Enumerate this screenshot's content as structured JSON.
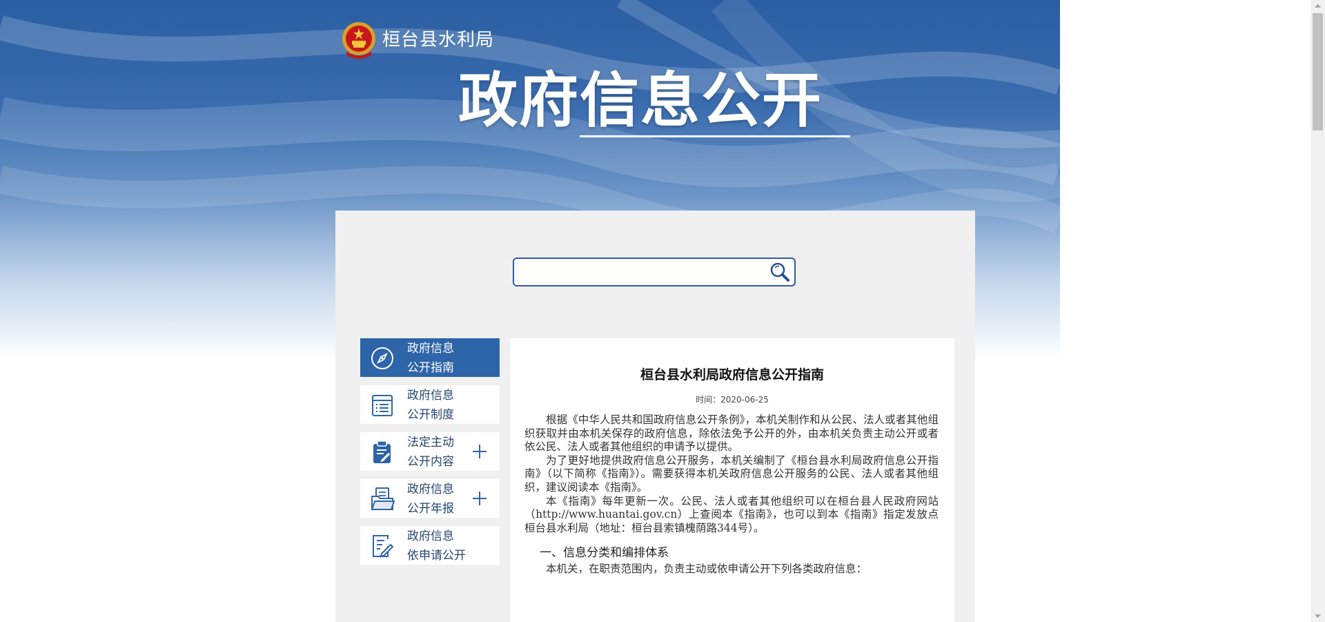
{
  "header": {
    "department": "桓台县水利局",
    "title": "政府信息公开"
  },
  "search": {
    "placeholder": "",
    "value": ""
  },
  "sidebar": {
    "items": [
      {
        "line1": "政府信息",
        "line2": "公开指南",
        "icon": "compass-icon",
        "active": true,
        "expandable": false
      },
      {
        "line1": "政府信息",
        "line2": "公开制度",
        "icon": "list-document-icon",
        "active": false,
        "expandable": false
      },
      {
        "line1": "法定主动",
        "line2": "公开内容",
        "icon": "clipboard-edit-icon",
        "active": false,
        "expandable": true
      },
      {
        "line1": "政府信息",
        "line2": "公开年报",
        "icon": "folder-document-icon",
        "active": false,
        "expandable": true
      },
      {
        "line1": "政府信息",
        "line2": "依申请公开",
        "icon": "form-pen-icon",
        "active": false,
        "expandable": false
      }
    ]
  },
  "article": {
    "title": "桓台县水利局政府信息公开指南",
    "date_label": "时间：",
    "date": "2020-06-25",
    "paragraphs": [
      "根据《中华人民共和国政府信息公开条例》，本机关制作和从公民、法人或者其他组织获取并由本机关保存的政府信息，除依法免予公开的外，由本机关负责主动公开或者依公民、法人或者其他组织的申请予以提供。",
      "为了更好地提供政府信息公开服务，本机关编制了《桓台县水利局政府信息公开指南》（以下简称《指南》）。需要获得本机关政府信息公开服务的公民、法人或者其他组织，建议阅读本《指南》。",
      "本《指南》每年更新一次。公民、法人或者其他组织可以在桓台县人民政府网站（http://www.huantai.gov.cn）上查阅本《指南》，也可以到本《指南》指定发放点桓台县水利局（地址：桓台县索镇槐荫路344号）。"
    ],
    "section_heading": "一、信息分类和编排体系",
    "section_paragraph": "本机关，在职责范围内，负责主动或依申请公开下列各类政府信息："
  },
  "colors": {
    "brand_blue": "#2e64a8",
    "panel_bg": "#f0f0f0",
    "search_border": "#2c5c9f"
  }
}
